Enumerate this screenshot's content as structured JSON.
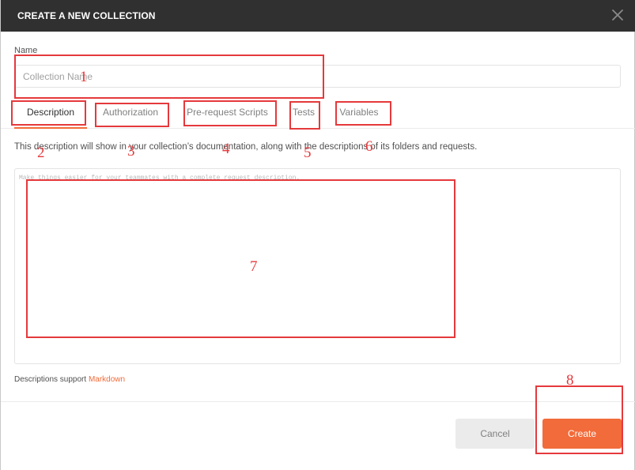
{
  "dialog": {
    "title": "CREATE A NEW COLLECTION",
    "close_icon": "close-icon"
  },
  "name": {
    "label": "Name",
    "value": "",
    "placeholder": "Collection Name"
  },
  "tabs": [
    {
      "label": "Description",
      "active": true
    },
    {
      "label": "Authorization",
      "active": false
    },
    {
      "label": "Pre-request Scripts",
      "active": false
    },
    {
      "label": "Tests",
      "active": false
    },
    {
      "label": "Variables",
      "active": false
    }
  ],
  "description": {
    "hint": "This description will show in your collection’s documentation, along with the descriptions of its folders and requests.",
    "value": "",
    "placeholder": "Make things easier for your teammates with a complete request description.",
    "support_text": "Descriptions support",
    "support_link": "Markdown"
  },
  "footer": {
    "cancel_label": "Cancel",
    "create_label": "Create"
  },
  "annotations": [
    "1",
    "2",
    "3",
    "4",
    "5",
    "6",
    "7",
    "8"
  ],
  "colors": {
    "header_bg": "#303030",
    "accent": "#f26b3a",
    "annotation": "#e5393c"
  }
}
